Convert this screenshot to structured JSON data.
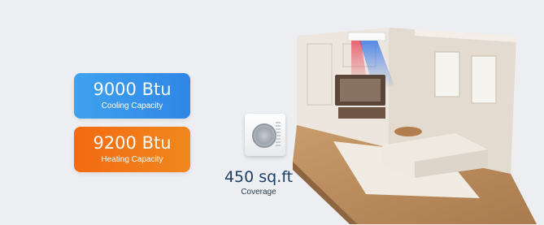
{
  "badges": {
    "cooling": {
      "value": "9000 Btu",
      "label": "Cooling Capacity"
    },
    "heating": {
      "value": "9200 Btu",
      "label": "Heating Capacity"
    }
  },
  "coverage": {
    "value": "450 sq.ft",
    "label": "Coverage"
  },
  "colors": {
    "cooling_badge": "#3a95ea",
    "heating_badge": "#f27817",
    "coverage_text": "#1d3f66",
    "panel_background": "#eceef1"
  },
  "illustrations": [
    "outdoor-unit-icon",
    "living-room-render"
  ]
}
